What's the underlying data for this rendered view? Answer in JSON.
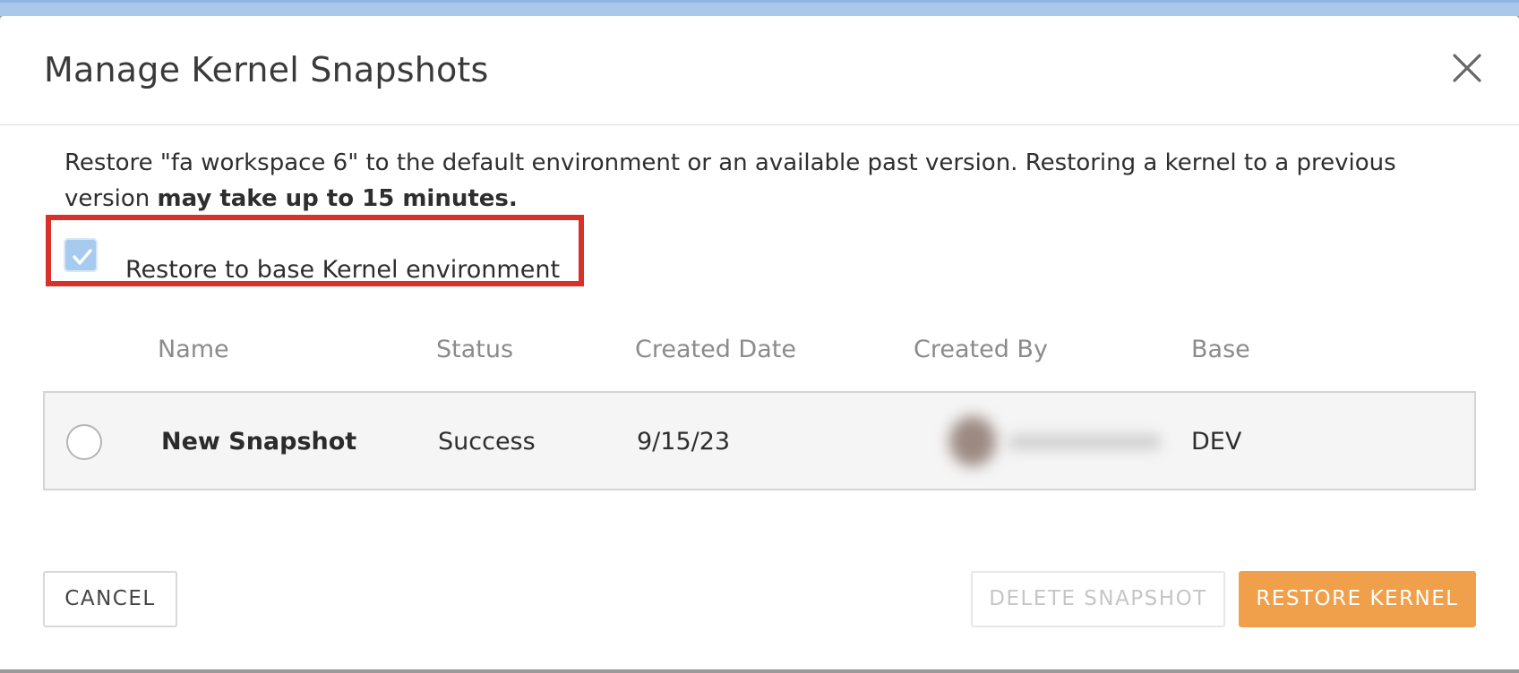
{
  "dialog": {
    "title": "Manage Kernel Snapshots",
    "close_icon": "close-icon"
  },
  "description": {
    "text": "Restore \"fa workspace 6\" to the default environment or an available past version. Restoring a kernel to a previous version ",
    "bold_text": "may take up to 15 minutes."
  },
  "restore_base": {
    "label": "Restore to base Kernel environment",
    "checked": true
  },
  "table": {
    "columns": [
      "Name",
      "Status",
      "Created Date",
      "Created By",
      "Base"
    ],
    "rows": [
      {
        "name": "New Snapshot",
        "status": "Success",
        "created_date": "9/15/23",
        "created_by": "",
        "base": "DEV",
        "selected": false
      }
    ]
  },
  "buttons": {
    "cancel": "CANCEL",
    "delete": "DELETE SNAPSHOT",
    "restore": "RESTORE KERNEL"
  },
  "colors": {
    "accent": "#f0a04b",
    "checkbox": "#a7cbee",
    "highlight": "#d9302a"
  }
}
